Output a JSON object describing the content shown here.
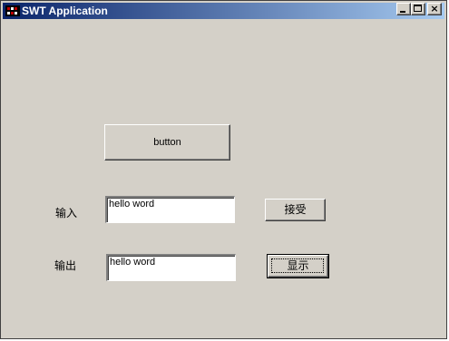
{
  "window": {
    "title": "SWT Application",
    "min_glyph": "_",
    "max_glyph": "□",
    "close_glyph": "×"
  },
  "content": {
    "main_button_label": "button",
    "input_label": "输入",
    "input_value": "hello word",
    "accept_button_label": "接受",
    "output_label": "输出",
    "output_value": "hello word",
    "display_button_label": "显示"
  },
  "colors": {
    "window_background": "#d4d0c8",
    "titlebar_start": "#0a246a",
    "titlebar_end": "#a6caf0",
    "title_text": "#ffffff",
    "field_background": "#ffffff"
  }
}
